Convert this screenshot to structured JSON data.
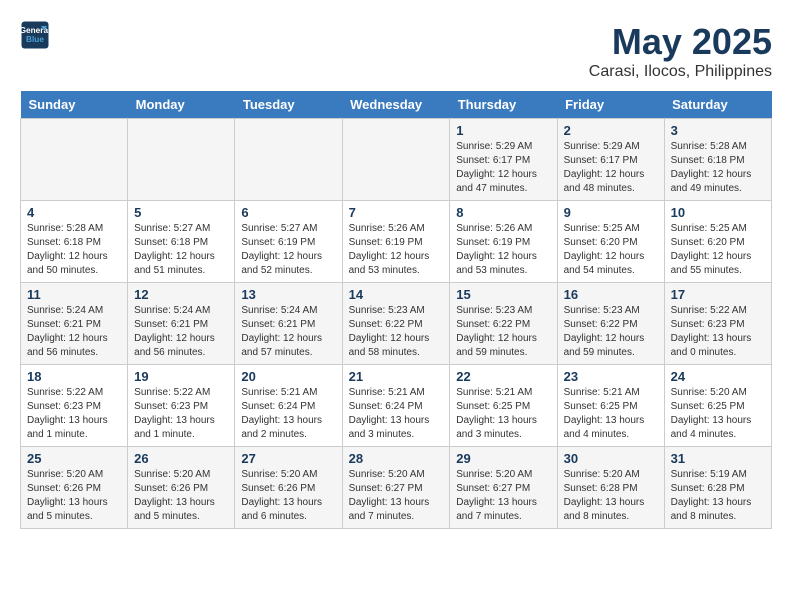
{
  "logo": {
    "line1": "General",
    "line2": "Blue"
  },
  "title": "May 2025",
  "subtitle": "Carasi, Ilocos, Philippines",
  "weekdays": [
    "Sunday",
    "Monday",
    "Tuesday",
    "Wednesday",
    "Thursday",
    "Friday",
    "Saturday"
  ],
  "weeks": [
    [
      {
        "day": "",
        "info": ""
      },
      {
        "day": "",
        "info": ""
      },
      {
        "day": "",
        "info": ""
      },
      {
        "day": "",
        "info": ""
      },
      {
        "day": "1",
        "info": "Sunrise: 5:29 AM\nSunset: 6:17 PM\nDaylight: 12 hours\nand 47 minutes."
      },
      {
        "day": "2",
        "info": "Sunrise: 5:29 AM\nSunset: 6:17 PM\nDaylight: 12 hours\nand 48 minutes."
      },
      {
        "day": "3",
        "info": "Sunrise: 5:28 AM\nSunset: 6:18 PM\nDaylight: 12 hours\nand 49 minutes."
      }
    ],
    [
      {
        "day": "4",
        "info": "Sunrise: 5:28 AM\nSunset: 6:18 PM\nDaylight: 12 hours\nand 50 minutes."
      },
      {
        "day": "5",
        "info": "Sunrise: 5:27 AM\nSunset: 6:18 PM\nDaylight: 12 hours\nand 51 minutes."
      },
      {
        "day": "6",
        "info": "Sunrise: 5:27 AM\nSunset: 6:19 PM\nDaylight: 12 hours\nand 52 minutes."
      },
      {
        "day": "7",
        "info": "Sunrise: 5:26 AM\nSunset: 6:19 PM\nDaylight: 12 hours\nand 53 minutes."
      },
      {
        "day": "8",
        "info": "Sunrise: 5:26 AM\nSunset: 6:19 PM\nDaylight: 12 hours\nand 53 minutes."
      },
      {
        "day": "9",
        "info": "Sunrise: 5:25 AM\nSunset: 6:20 PM\nDaylight: 12 hours\nand 54 minutes."
      },
      {
        "day": "10",
        "info": "Sunrise: 5:25 AM\nSunset: 6:20 PM\nDaylight: 12 hours\nand 55 minutes."
      }
    ],
    [
      {
        "day": "11",
        "info": "Sunrise: 5:24 AM\nSunset: 6:21 PM\nDaylight: 12 hours\nand 56 minutes."
      },
      {
        "day": "12",
        "info": "Sunrise: 5:24 AM\nSunset: 6:21 PM\nDaylight: 12 hours\nand 56 minutes."
      },
      {
        "day": "13",
        "info": "Sunrise: 5:24 AM\nSunset: 6:21 PM\nDaylight: 12 hours\nand 57 minutes."
      },
      {
        "day": "14",
        "info": "Sunrise: 5:23 AM\nSunset: 6:22 PM\nDaylight: 12 hours\nand 58 minutes."
      },
      {
        "day": "15",
        "info": "Sunrise: 5:23 AM\nSunset: 6:22 PM\nDaylight: 12 hours\nand 59 minutes."
      },
      {
        "day": "16",
        "info": "Sunrise: 5:23 AM\nSunset: 6:22 PM\nDaylight: 12 hours\nand 59 minutes."
      },
      {
        "day": "17",
        "info": "Sunrise: 5:22 AM\nSunset: 6:23 PM\nDaylight: 13 hours\nand 0 minutes."
      }
    ],
    [
      {
        "day": "18",
        "info": "Sunrise: 5:22 AM\nSunset: 6:23 PM\nDaylight: 13 hours\nand 1 minute."
      },
      {
        "day": "19",
        "info": "Sunrise: 5:22 AM\nSunset: 6:23 PM\nDaylight: 13 hours\nand 1 minute."
      },
      {
        "day": "20",
        "info": "Sunrise: 5:21 AM\nSunset: 6:24 PM\nDaylight: 13 hours\nand 2 minutes."
      },
      {
        "day": "21",
        "info": "Sunrise: 5:21 AM\nSunset: 6:24 PM\nDaylight: 13 hours\nand 3 minutes."
      },
      {
        "day": "22",
        "info": "Sunrise: 5:21 AM\nSunset: 6:25 PM\nDaylight: 13 hours\nand 3 minutes."
      },
      {
        "day": "23",
        "info": "Sunrise: 5:21 AM\nSunset: 6:25 PM\nDaylight: 13 hours\nand 4 minutes."
      },
      {
        "day": "24",
        "info": "Sunrise: 5:20 AM\nSunset: 6:25 PM\nDaylight: 13 hours\nand 4 minutes."
      }
    ],
    [
      {
        "day": "25",
        "info": "Sunrise: 5:20 AM\nSunset: 6:26 PM\nDaylight: 13 hours\nand 5 minutes."
      },
      {
        "day": "26",
        "info": "Sunrise: 5:20 AM\nSunset: 6:26 PM\nDaylight: 13 hours\nand 5 minutes."
      },
      {
        "day": "27",
        "info": "Sunrise: 5:20 AM\nSunset: 6:26 PM\nDaylight: 13 hours\nand 6 minutes."
      },
      {
        "day": "28",
        "info": "Sunrise: 5:20 AM\nSunset: 6:27 PM\nDaylight: 13 hours\nand 7 minutes."
      },
      {
        "day": "29",
        "info": "Sunrise: 5:20 AM\nSunset: 6:27 PM\nDaylight: 13 hours\nand 7 minutes."
      },
      {
        "day": "30",
        "info": "Sunrise: 5:20 AM\nSunset: 6:28 PM\nDaylight: 13 hours\nand 8 minutes."
      },
      {
        "day": "31",
        "info": "Sunrise: 5:19 AM\nSunset: 6:28 PM\nDaylight: 13 hours\nand 8 minutes."
      }
    ]
  ]
}
